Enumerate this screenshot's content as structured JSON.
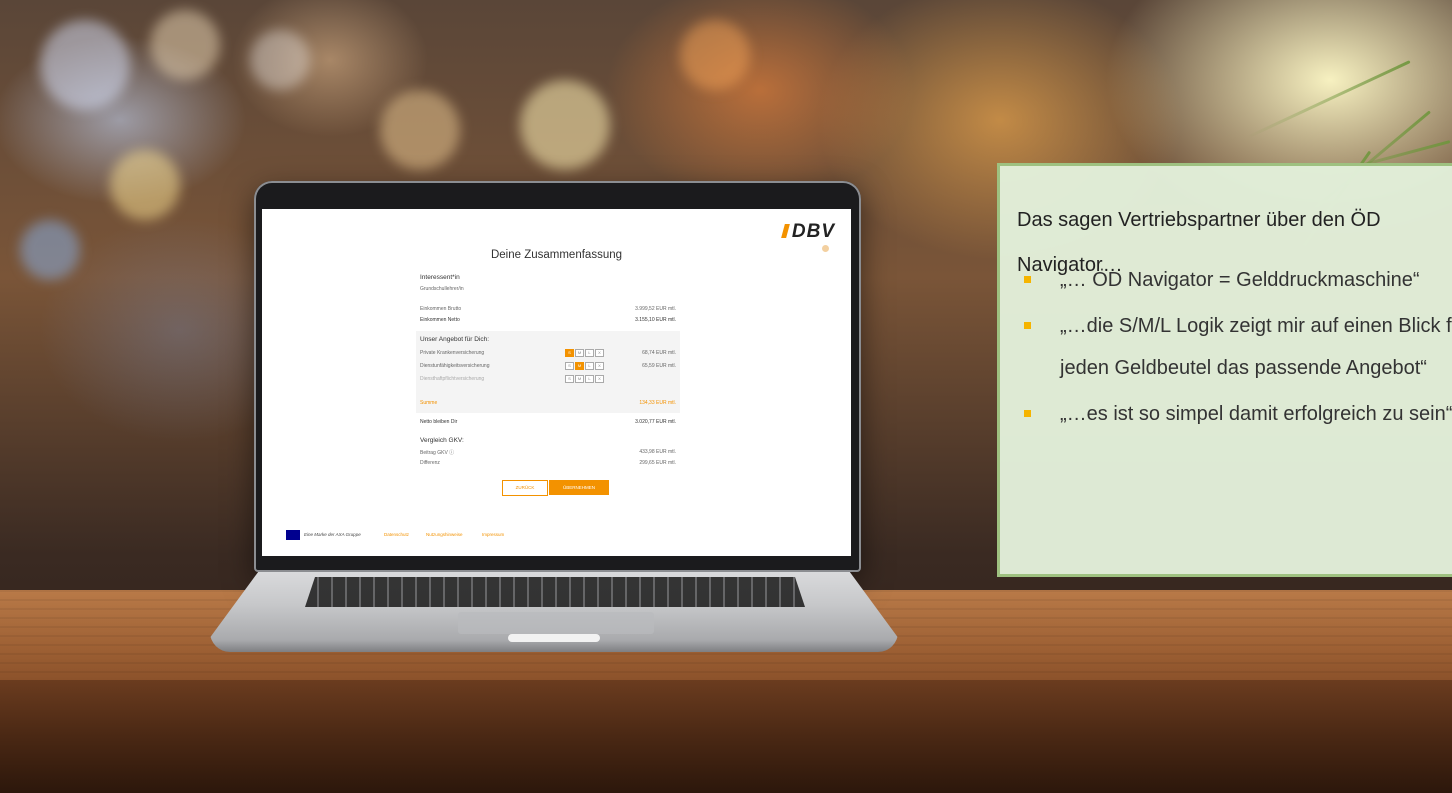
{
  "screen": {
    "brand": "DBV",
    "title": "Deine Zusammenfassung",
    "interessent_label": "Interessent*in",
    "interessent_value": "Grundschullehrer/in",
    "income": [
      {
        "label": "Einkommen Brutto",
        "value": "3.999,52 EUR mtl."
      },
      {
        "label": "Einkommen Netto",
        "value": "3.155,10 EUR mtl."
      }
    ],
    "offer_heading": "Unser Angebot für Dich:",
    "offers": [
      {
        "label": "Private Krankenversicherung",
        "value": "68,74 EUR mtl.",
        "sizes": [
          "S",
          "M",
          "L",
          "X"
        ]
      },
      {
        "label": "Dienstunfähigkeitsversicherung",
        "value": "65,59 EUR mtl.",
        "sizes": [
          "S",
          "M",
          "L",
          "X"
        ]
      },
      {
        "label": "Diensthaftpflichtversicherung",
        "value": "",
        "sizes": [
          "S",
          "M",
          "L",
          "X"
        ]
      }
    ],
    "sum_label": "Summe",
    "sum_value": "134,33 EUR mtl.",
    "net_label": "Netto bleiben Dir",
    "net_value": "3.020,77 EUR mtl.",
    "compare_heading": "Vergleich GKV:",
    "compare": [
      {
        "label": "Beitrag GKV ⓘ",
        "value": "433,98 EUR mtl."
      },
      {
        "label": "Differenz",
        "value": "299,65 EUR mtl."
      }
    ],
    "back_button": "ZURÜCK",
    "ok_button": "ÜBERNEHMEN",
    "footer_brand": "Eine Marke der AXA Gruppe",
    "footer_links": [
      "Datenschutz",
      "Nutzungshinweise",
      "Impressum"
    ]
  },
  "quote_box": {
    "title": "Das sagen Vertriebspartner über den ÖD Navigator…",
    "items": [
      "„… ÖD Navigator = Gelddruckmaschine“",
      "„…die S/M/L Logik zeigt mir auf einen Blick für",
      "jeden Geldbeutel das passende Angebot“",
      "„…es ist so simpel damit erfolgreich zu sein“"
    ]
  },
  "colors": {
    "accent": "#f39200",
    "box_bg": "#e2efda",
    "box_border": "#9ec180",
    "bullet": "#f5b400"
  }
}
